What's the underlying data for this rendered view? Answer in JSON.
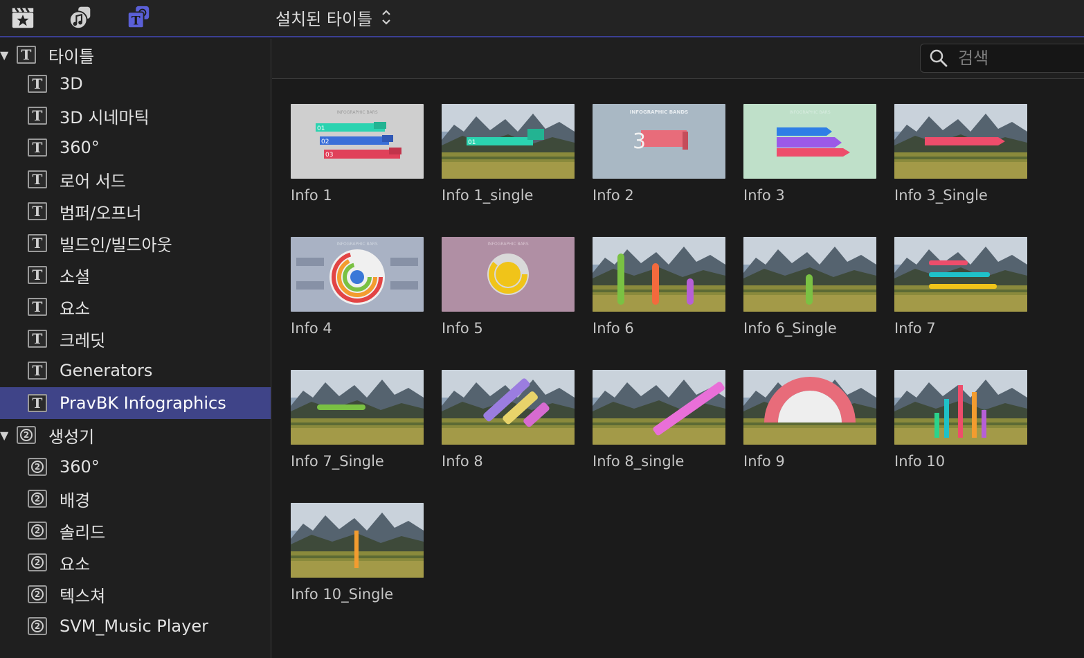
{
  "toolbar": {
    "icons": [
      "clapper-star-icon",
      "photos-music-icon",
      "titles-generators-icon"
    ],
    "active_icon": "titles-generators-icon",
    "popup_title": "설치된 타이틀"
  },
  "sidebar": {
    "groups": [
      {
        "label": "타이틀",
        "icon": "T",
        "expanded": true,
        "items": [
          {
            "label": "3D"
          },
          {
            "label": "3D 시네마틱"
          },
          {
            "label": "360°"
          },
          {
            "label": "로어 서드"
          },
          {
            "label": "범퍼/오프너"
          },
          {
            "label": "빌드인/빌드아웃"
          },
          {
            "label": "소셜"
          },
          {
            "label": "요소"
          },
          {
            "label": "크레딧"
          },
          {
            "label": "Generators"
          },
          {
            "label": "PravBK Infographics",
            "selected": true
          }
        ]
      },
      {
        "label": "생성기",
        "icon": "2",
        "expanded": true,
        "items": [
          {
            "label": "360°"
          },
          {
            "label": "배경"
          },
          {
            "label": "솔리드"
          },
          {
            "label": "요소"
          },
          {
            "label": "텍스쳐"
          },
          {
            "label": "SVM_Music Player"
          }
        ]
      }
    ]
  },
  "search": {
    "placeholder": "검색",
    "value": ""
  },
  "colors": {
    "accent": "#3f4488",
    "selected_text": "#ffffff"
  },
  "clips": [
    {
      "name": "Info 1",
      "style": "bars3"
    },
    {
      "name": "Info 1_single",
      "style": "landscape-bar"
    },
    {
      "name": "Info 2",
      "style": "band"
    },
    {
      "name": "Info 3",
      "style": "arrows"
    },
    {
      "name": "Info 3_Single",
      "style": "landscape-arrow"
    },
    {
      "name": "Info 4",
      "style": "rings"
    },
    {
      "name": "Info 5",
      "style": "donut"
    },
    {
      "name": "Info 6",
      "style": "landscape-vbars3"
    },
    {
      "name": "Info 6_Single",
      "style": "landscape-vbar"
    },
    {
      "name": "Info 7",
      "style": "landscape-hbars3"
    },
    {
      "name": "Info 7_Single",
      "style": "landscape-hbar"
    },
    {
      "name": "Info 8",
      "style": "landscape-diag3"
    },
    {
      "name": "Info 8_single",
      "style": "landscape-diag"
    },
    {
      "name": "Info 9",
      "style": "landscape-gauge"
    },
    {
      "name": "Info 10",
      "style": "landscape-columns"
    },
    {
      "name": "Info 10_Single",
      "style": "landscape-column"
    }
  ]
}
